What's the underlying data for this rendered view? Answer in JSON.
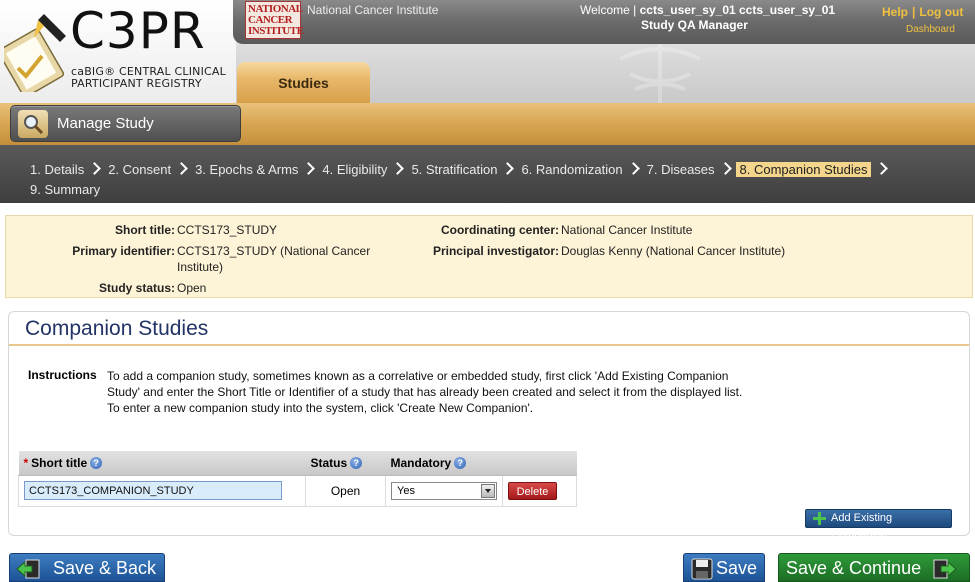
{
  "header": {
    "logo_text": "C3PR",
    "logo_subtitle_line1": "caBIG® CENTRAL CLINICAL",
    "logo_subtitle_line2": "PARTICIPANT REGISTRY",
    "nci_logo_text": "NATIONAL CANCER INSTITUTE",
    "nci_name": "National Cancer Institute",
    "welcome_prefix": "Welcome |",
    "user_name": "ccts_user_sy_01 ccts_user_sy_01",
    "user_role": "Study QA Manager",
    "help_label": "Help",
    "logout_label": "Log out",
    "dashboard_label": "Dashboard",
    "tab_label": "Studies"
  },
  "manage_bar": {
    "title": "Manage Study"
  },
  "steps": [
    {
      "label": "1. Details"
    },
    {
      "label": "2. Consent"
    },
    {
      "label": "3. Epochs & Arms"
    },
    {
      "label": "4. Eligibility"
    },
    {
      "label": "5. Stratification"
    },
    {
      "label": "6. Randomization"
    },
    {
      "label": "7. Diseases"
    },
    {
      "label": "8. Companion Studies"
    },
    {
      "label": "9. Summary"
    }
  ],
  "active_step": "8. Companion Studies",
  "summary": {
    "short_title_label": "Short title:",
    "short_title_value": "CCTS173_STUDY",
    "primary_identifier_label": "Primary identifier:",
    "primary_identifier_value_line1": "CCTS173_STUDY (National Cancer",
    "primary_identifier_value_line2": "Institute)",
    "study_status_label": "Study status:",
    "study_status_value": "Open",
    "coordinating_center_label": "Coordinating center:",
    "coordinating_center_value": "National Cancer Institute",
    "principal_investigator_label": "Principal investigator:",
    "principal_investigator_value": "Douglas Kenny (National Cancer Institute)"
  },
  "panel": {
    "title": "Companion Studies",
    "instructions_label": "Instructions",
    "instructions_line1": "To add a companion study, sometimes known as a correlative or embedded study, first click 'Add Existing Companion",
    "instructions_line2": "Study' and enter the Short Title or Identifier of a study that has already been created and select it from the displayed list.",
    "instructions_line3": "To enter a new companion study into the system, click 'Create New Companion'.",
    "table": {
      "required_marker": "*",
      "columns": [
        "Short title",
        "Status",
        "Mandatory"
      ],
      "rows": [
        {
          "short_title": "CCTS173_COMPANION_STUDY",
          "status": "Open",
          "mandatory": "Yes",
          "delete_label": "Delete"
        }
      ]
    },
    "add_existing_label": "Add Existing Companion"
  },
  "footer": {
    "save_back_label": "Save & Back",
    "save_label": "Save",
    "save_continue_label": "Save & Continue"
  },
  "colors": {
    "accent_gold": "#d7a552",
    "active_step_bg": "#f3d58c",
    "summary_bg": "#fdf3d6",
    "title_blue": "#223366",
    "button_blue": "#1d5396",
    "button_green": "#1b6d24",
    "delete_red": "#a31818"
  }
}
